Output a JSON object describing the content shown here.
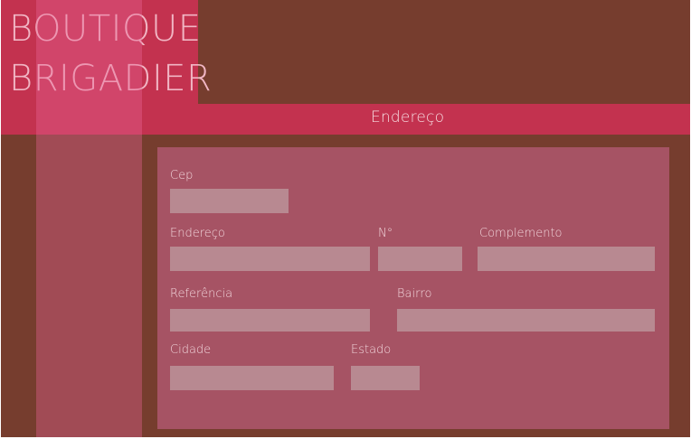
{
  "brand": {
    "line1": "BOUTIQUE",
    "line2": "BRIGADIER"
  },
  "section": {
    "title": "Endereço"
  },
  "form": {
    "cep": {
      "label": "Cep",
      "value": ""
    },
    "endereco": {
      "label": "Endereço",
      "value": ""
    },
    "numero": {
      "label": "N°",
      "value": ""
    },
    "complemento": {
      "label": "Complemento",
      "value": ""
    },
    "referencia": {
      "label": "Referência",
      "value": ""
    },
    "bairro": {
      "label": "Bairro",
      "value": ""
    },
    "cidade": {
      "label": "Cidade",
      "value": ""
    },
    "estado": {
      "label": "Estado",
      "value": ""
    }
  },
  "colors": {
    "background": "#763d2e",
    "accent": "#c3324f",
    "panel": "#a65364",
    "field": "#b88991",
    "text": "#f2d6dc"
  }
}
